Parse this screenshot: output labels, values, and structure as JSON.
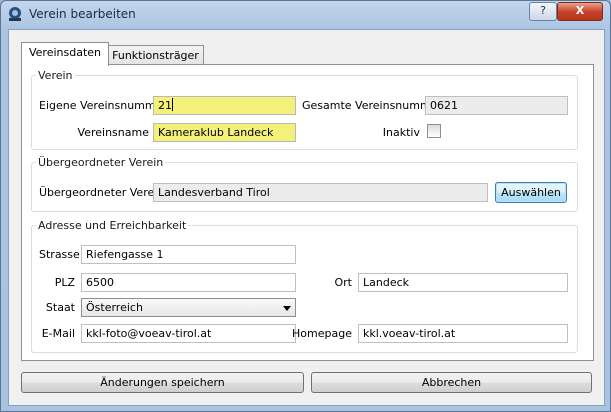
{
  "window": {
    "title": "Verein bearbeiten",
    "help_label": "?",
    "close_label": "X"
  },
  "tabs": [
    {
      "label": "Vereinsdaten"
    },
    {
      "label": "Funktionsträger"
    }
  ],
  "verein": {
    "group_title": "Verein",
    "eigene_nr_label": "Eigene Vereinsnummer",
    "eigene_nr_value": "21",
    "gesamte_nr_label": "Gesamte Vereinsnummer",
    "gesamte_nr_value": "0621",
    "name_label": "Vereinsname",
    "name_value": "Kameraklub Landeck",
    "inaktiv_label": "Inaktiv"
  },
  "uebergeordnet": {
    "group_title": "Übergeordneter Verein",
    "label": "Übergeordneter Verein",
    "value": "Landesverband Tirol",
    "button_label": "Auswählen"
  },
  "adresse": {
    "group_title": "Adresse und Erreichbarkeit",
    "strasse_label": "Strasse",
    "strasse_value": "Riefengasse 1",
    "plz_label": "PLZ",
    "plz_value": "6500",
    "ort_label": "Ort",
    "ort_value": "Landeck",
    "staat_label": "Staat",
    "staat_value": "Österreich",
    "email_label": "E-Mail",
    "email_value": "kkl-foto@voeav-tirol.at",
    "homepage_label": "Homepage",
    "homepage_value": "kkl.voeav-tirol.at"
  },
  "footer": {
    "save_label": "Änderungen speichern",
    "cancel_label": "Abbrechen"
  }
}
